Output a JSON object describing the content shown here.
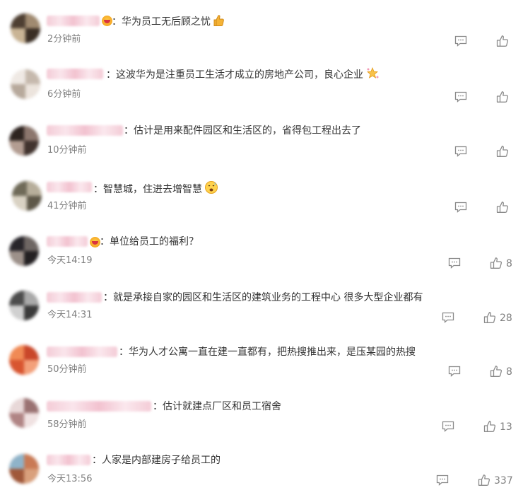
{
  "separator": "：",
  "comments": [
    {
      "text": "华为员工无后顾之忧",
      "time": "2分钟前",
      "likes": "",
      "emoji": "thumbs-up-emoji",
      "badge": true
    },
    {
      "text": "这波华为是注重员工生活才成立的房地产公司，良心企业",
      "time": "6分钟前",
      "likes": "",
      "emoji": "sparkle-emoji",
      "badge": false
    },
    {
      "text": "估计是用来配件园区和生活区的，省得包工程出去了",
      "time": "10分钟前",
      "likes": "",
      "emoji": "",
      "badge": false
    },
    {
      "text": "智慧城，住进去增智慧",
      "time": "41分钟前",
      "likes": "",
      "emoji": "sweat-face-emoji",
      "badge": false
    },
    {
      "text": "单位给员工的福利？",
      "time": "今天14:19",
      "likes": "8",
      "emoji": "",
      "badge": true
    },
    {
      "text": "就是承接自家的园区和生活区的建筑业务的工程中心 很多大型企业都有",
      "time": "今天14:31",
      "likes": "28",
      "emoji": "",
      "badge": false
    },
    {
      "text": "华为人才公寓一直在建一直都有，把热搜推出来，是压某园的热搜",
      "time": "50分钟前",
      "likes": "8",
      "emoji": "",
      "badge": false
    },
    {
      "text": "估计就建点厂区和员工宿舍",
      "time": "58分钟前",
      "likes": "13",
      "emoji": "",
      "badge": false
    },
    {
      "text": "人家是内部建房子给员工的",
      "time": "今天13:56",
      "likes": "337",
      "emoji": "",
      "badge": false
    }
  ],
  "colors": {
    "text": "#333333",
    "meta": "#808080",
    "name_blur": "#f3c7d3"
  }
}
